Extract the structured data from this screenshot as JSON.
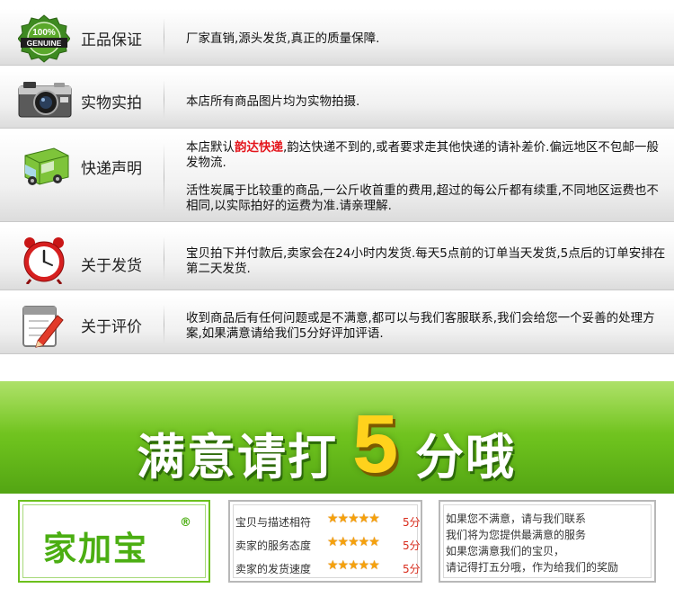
{
  "policies": [
    {
      "icon": "genuine-badge-icon",
      "badge_top": "100%",
      "badge_main": "GENUINE",
      "title": "正品保证",
      "desc": [
        "厂家直销,源头发货,真正的质量保障."
      ]
    },
    {
      "icon": "camera-icon",
      "title": "实物实拍",
      "desc": [
        "本店所有商品图片均为实物拍摄."
      ]
    },
    {
      "icon": "delivery-truck-icon",
      "title": "快递声明",
      "desc_p1_pre": "本店默认",
      "desc_p1_highlight": "韵达快递",
      "desc_p1_post": ",韵达快递不到的,或者要求走其他快递的请补差价.偏远地区不包邮一般发物流.",
      "desc_p2": "活性炭属于比较重的商品,一公斤收首重的费用,超过的每公斤都有续重,不同地区运费也不相同,以实际拍好的运费为准.请亲理解."
    },
    {
      "icon": "alarm-clock-icon",
      "title": "关于发货",
      "desc": [
        "宝贝拍下并付款后,卖家会在24小时内发货.每天5点前的订单当天发货,5点后的订单安排在第二天发货."
      ]
    },
    {
      "icon": "notepad-pencil-icon",
      "title": "关于评价",
      "desc": [
        "收到商品后有任何问题或是不满意,都可以与我们客服联系,我们会给您一个妥善的处理方案,如果满意请给我们5分好评加评语."
      ]
    }
  ],
  "banner": {
    "text_before": "满意请打",
    "number": "5",
    "text_after": "分哦"
  },
  "brand": {
    "name": "家加宝",
    "reg_mark": "®"
  },
  "ratings": [
    {
      "label": "宝贝与描述相符",
      "stars": "★★★★★",
      "score": "5分",
      "value": 5
    },
    {
      "label": "卖家的服务态度",
      "stars": "★★★★★",
      "score": "5分",
      "value": 5
    },
    {
      "label": "卖家的发货速度",
      "stars": "★★★★★",
      "score": "5分",
      "value": 5
    }
  ],
  "note": [
    "如果您不满意，请与我们联系",
    "我们将为您提供最满意的服务",
    "如果您满意我们的宝贝，",
    "请记得打五分哦，作为给我们的奖励"
  ],
  "colors": {
    "accent_green": "#6cc01d",
    "highlight_red": "#e4161d",
    "star_orange": "#f5a10c",
    "five_yellow": "#ffd21c"
  }
}
